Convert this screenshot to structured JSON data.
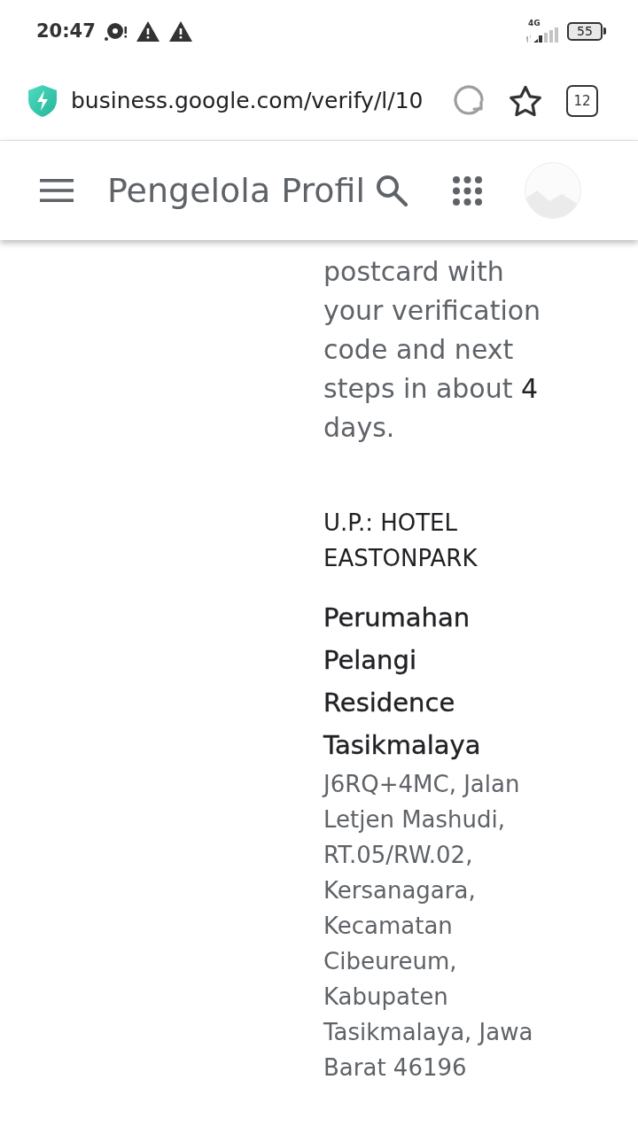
{
  "status_bar": {
    "time": "20:47",
    "network": "4G",
    "battery": "55"
  },
  "browser": {
    "url": "business.google.com/verify/l/10",
    "tab_count": "12"
  },
  "app_bar": {
    "title": "Pengelola Profil"
  },
  "content": {
    "message": "postcard with your verification code and next steps in about **4** days.",
    "recipient": "U.P.: HOTEL EASTONPARK",
    "business_name": "Perumahan Pelangi Residence Tasikmalaya",
    "address": "J6RQ+4MC, Jalan Letjen Mashudi, RT.05/RW.02, Kersanagara, Kecamatan Cibeureum, Kabupaten Tasikmalaya, Jawa Barat 46196"
  }
}
